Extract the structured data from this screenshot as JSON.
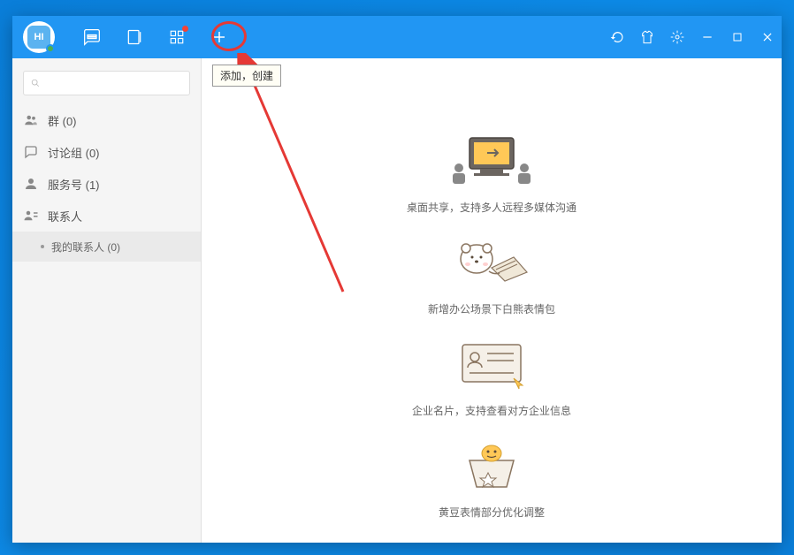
{
  "logo_text": "HI",
  "tooltip_text": "添加，创建",
  "sidebar": {
    "groups_label": "群 (0)",
    "discussion_label": "讨论组 (0)",
    "service_label": "服务号 (1)",
    "contacts_label": "联系人",
    "my_contacts_label": "我的联系人 (0)"
  },
  "features": {
    "f1": "桌面共享，支持多人远程多媒体沟通",
    "f2": "新增办公场景下白熊表情包",
    "f3": "企业名片，支持查看对方企业信息",
    "f4": "黄豆表情部分优化调整"
  }
}
